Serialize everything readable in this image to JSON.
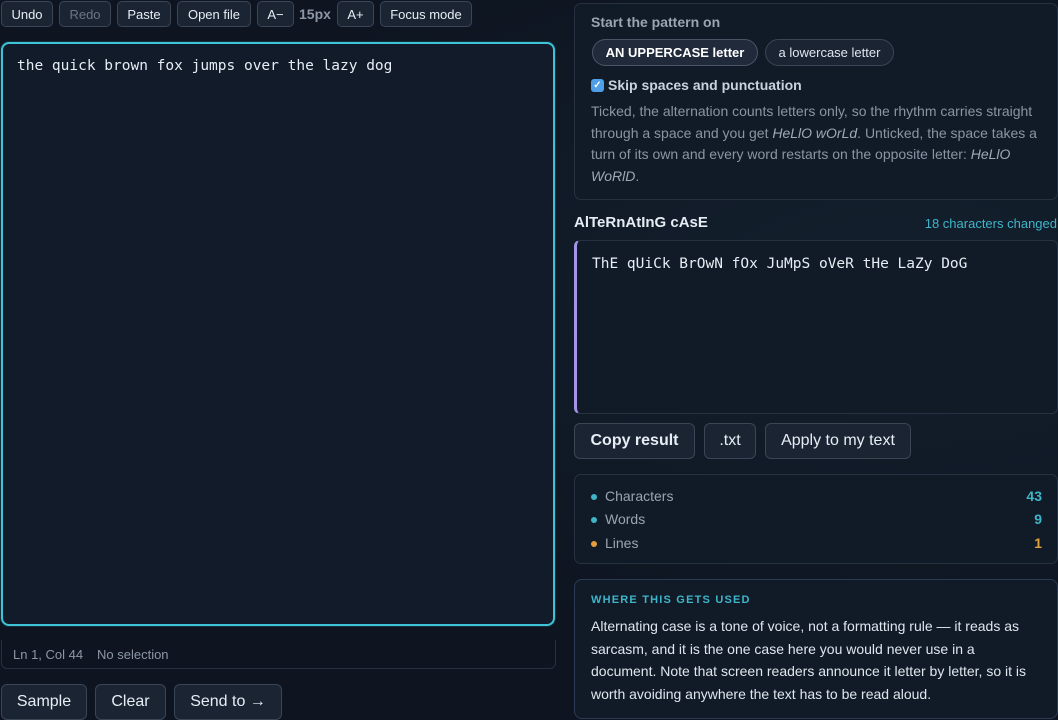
{
  "toolbar": {
    "undo": "Undo",
    "redo": "Redo",
    "paste": "Paste",
    "open_file": "Open file",
    "font_smaller": "A−",
    "font_size": "15px",
    "font_larger": "A+",
    "focus_mode": "Focus mode"
  },
  "editor": {
    "text": "the quick brown fox jumps over the lazy dog"
  },
  "statusbar": {
    "position": "Ln 1, Col 44",
    "selection": "No selection"
  },
  "actions": {
    "sample": "Sample",
    "clear": "Clear",
    "send_to": "Send to →"
  },
  "pattern": {
    "title": "Start the pattern on",
    "options": [
      "AN UPPERCASE letter",
      "a lowercase letter"
    ],
    "selected": "AN UPPERCASE letter",
    "skip_label": "Skip spaces and punctuation",
    "skip_checked": true,
    "help_1": "Ticked, the alternation counts letters only, so the rhythm carries straight through a space and you get ",
    "help_ex1": "HeLlO wOrLd",
    "help_2": ". Unticked, the space takes a turn of its own and every word restarts on the opposite letter: ",
    "help_ex2": "HeLlO WoRlD",
    "help_3": "."
  },
  "result": {
    "title": "AlTeRnAtInG cAsE",
    "changed": "18 characters changed",
    "text": "ThE qUiCk BrOwN fOx JuMpS oVeR tHe LaZy DoG",
    "copy": "Copy result",
    "txt": ".txt",
    "apply": "Apply to my text"
  },
  "stats": [
    {
      "label": "Characters",
      "value": "43",
      "color": "#3fb5c9"
    },
    {
      "label": "Words",
      "value": "9",
      "color": "#3fb5c9"
    },
    {
      "label": "Lines",
      "value": "1",
      "color": "#e0a13a"
    }
  ],
  "info": {
    "title": "WHERE THIS GETS USED",
    "body": "Alternating case is a tone of voice, not a formatting rule — it reads as sarcasm, and it is the one case here you would never use in a document. Note that screen readers announce it letter by letter, so it is worth avoiding anywhere the text has to be read aloud."
  }
}
